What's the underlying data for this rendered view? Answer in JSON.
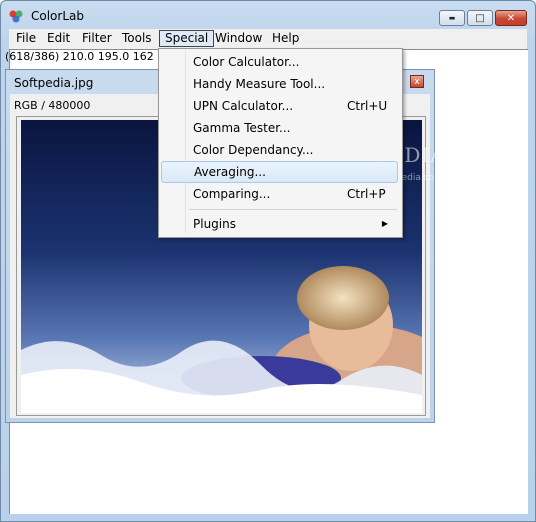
{
  "app": {
    "title": "ColorLab"
  },
  "window_buttons": {
    "minimize": "▬",
    "maximize": "□",
    "close": "✕"
  },
  "menubar": {
    "items": [
      {
        "label": "File"
      },
      {
        "label": "Edit"
      },
      {
        "label": "Filter"
      },
      {
        "label": "Tools"
      },
      {
        "label": "Special"
      },
      {
        "label": "Window"
      },
      {
        "label": "Help"
      }
    ]
  },
  "status_line": "(618/386) 210.0 195.0 162.0 c",
  "child_window": {
    "title": "Softpedia.jpg",
    "info": "RGB / 480000",
    "close": "x"
  },
  "special_menu": {
    "items": [
      {
        "label": "Color Calculator...",
        "shortcut": ""
      },
      {
        "label": "Handy Measure Tool...",
        "shortcut": ""
      },
      {
        "label": "UPN Calculator...",
        "shortcut": "Ctrl+U"
      },
      {
        "label": "Gamma Tester...",
        "shortcut": ""
      },
      {
        "label": "Color Dependancy...",
        "shortcut": ""
      },
      {
        "label": "Averaging...",
        "shortcut": "",
        "highlighted": true
      },
      {
        "label": "Comparing...",
        "shortcut": "Ctrl+P"
      },
      {
        "label": "Plugins",
        "shortcut": "",
        "submenu": true
      }
    ],
    "submenu_arrow": "▶"
  },
  "watermark": {
    "text": "SOFTPEDIA",
    "url": "www.softpedia.com"
  }
}
